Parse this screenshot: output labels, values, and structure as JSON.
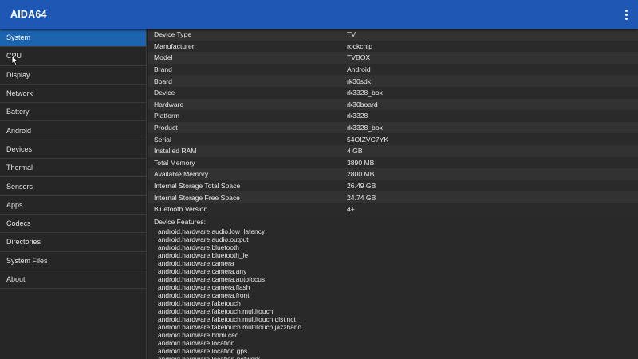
{
  "app": {
    "title": "AIDA64",
    "menu_icon": "more-vert-icon",
    "accent": "#1e57b4",
    "selected": "#1c63b0"
  },
  "sidebar": {
    "items": [
      {
        "label": "System",
        "active": true
      },
      {
        "label": "CPU",
        "active": false
      },
      {
        "label": "Display",
        "active": false
      },
      {
        "label": "Network",
        "active": false
      },
      {
        "label": "Battery",
        "active": false
      },
      {
        "label": "Android",
        "active": false
      },
      {
        "label": "Devices",
        "active": false
      },
      {
        "label": "Thermal",
        "active": false
      },
      {
        "label": "Sensors",
        "active": false
      },
      {
        "label": "Apps",
        "active": false
      },
      {
        "label": "Codecs",
        "active": false
      },
      {
        "label": "Directories",
        "active": false
      },
      {
        "label": "System Files",
        "active": false
      },
      {
        "label": "About",
        "active": false
      }
    ]
  },
  "system": {
    "rows": [
      {
        "key": "Device Type",
        "value": "TV"
      },
      {
        "key": "Manufacturer",
        "value": "rockchip"
      },
      {
        "key": "Model",
        "value": "TVBOX"
      },
      {
        "key": "Brand",
        "value": "Android"
      },
      {
        "key": "Board",
        "value": "rk30sdk"
      },
      {
        "key": "Device",
        "value": "rk3328_box"
      },
      {
        "key": "Hardware",
        "value": "rk30board"
      },
      {
        "key": "Platform",
        "value": "rk3328"
      },
      {
        "key": "Product",
        "value": "rk3328_box"
      },
      {
        "key": "Serial",
        "value": "54OIZVC7YK"
      },
      {
        "key": "Installed RAM",
        "value": "4 GB"
      },
      {
        "key": "Total Memory",
        "value": "3890 MB"
      },
      {
        "key": "Available Memory",
        "value": "2800 MB"
      },
      {
        "key": "Internal Storage Total Space",
        "value": "26.49 GB"
      },
      {
        "key": "Internal Storage Free Space",
        "value": "24.74 GB"
      },
      {
        "key": "Bluetooth Version",
        "value": "4+"
      }
    ],
    "features_label": "Device Features:",
    "features": [
      "android.hardware.audio.low_latency",
      "android.hardware.audio.output",
      "android.hardware.bluetooth",
      "android.hardware.bluetooth_le",
      "android.hardware.camera",
      "android.hardware.camera.any",
      "android.hardware.camera.autofocus",
      "android.hardware.camera.flash",
      "android.hardware.camera.front",
      "android.hardware.faketouch",
      "android.hardware.faketouch.multitouch",
      "android.hardware.faketouch.multitouch.distinct",
      "android.hardware.faketouch.multitouch.jazzhand",
      "android.hardware.hdmi.cec",
      "android.hardware.location",
      "android.hardware.location.gps",
      "android.hardware.location.network"
    ]
  }
}
